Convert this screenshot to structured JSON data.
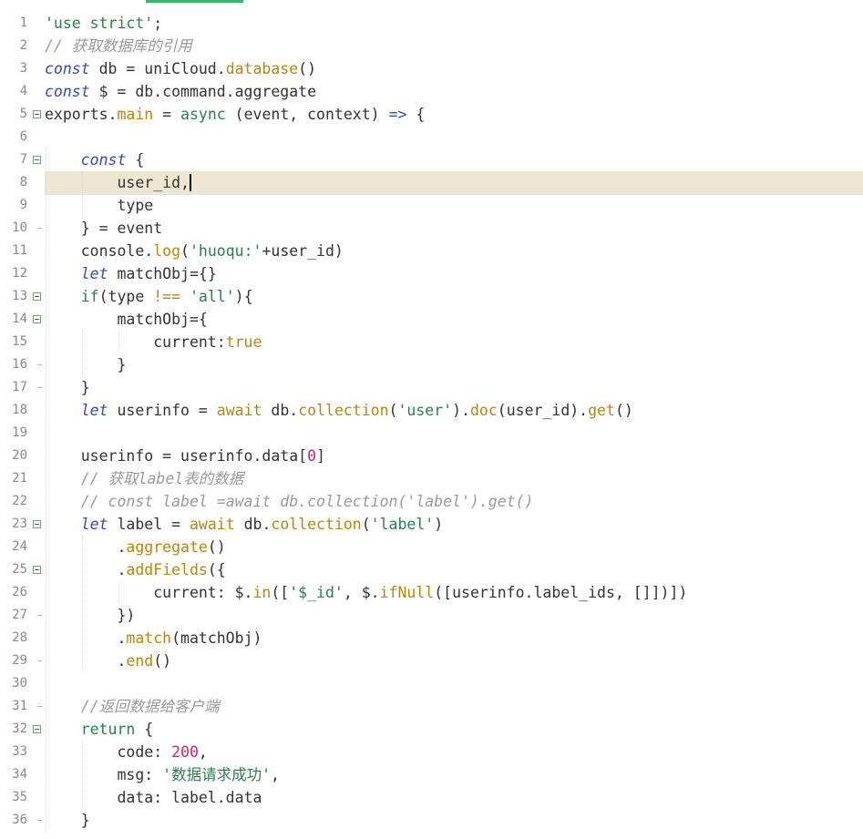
{
  "editor": {
    "lines": [
      {
        "n": "1",
        "fold": "",
        "tokens": [
          {
            "t": "'use strict'",
            "c": "str"
          },
          {
            "t": ";",
            "c": "plain"
          }
        ]
      },
      {
        "n": "2",
        "fold": "",
        "tokens": [
          {
            "t": "// 获取数据库的引用",
            "c": "cmt"
          }
        ]
      },
      {
        "n": "3",
        "fold": "",
        "tokens": [
          {
            "t": "const",
            "c": "kw"
          },
          {
            "t": " db = uniCloud.",
            "c": "plain"
          },
          {
            "t": "database",
            "c": "fn"
          },
          {
            "t": "()",
            "c": "plain"
          }
        ]
      },
      {
        "n": "4",
        "fold": "",
        "tokens": [
          {
            "t": "const",
            "c": "kw"
          },
          {
            "t": " $ = db.command.aggregate",
            "c": "plain"
          }
        ]
      },
      {
        "n": "5",
        "fold": "box",
        "tokens": [
          {
            "t": "exports.",
            "c": "plain"
          },
          {
            "t": "main",
            "c": "fn"
          },
          {
            "t": " = ",
            "c": "plain"
          },
          {
            "t": "async",
            "c": "kw2"
          },
          {
            "t": " (event, context) ",
            "c": "plain"
          },
          {
            "t": "=>",
            "c": "kw"
          },
          {
            "t": " {",
            "c": "plain"
          }
        ]
      },
      {
        "n": "6",
        "fold": "",
        "tokens": []
      },
      {
        "n": "7",
        "fold": "box",
        "tokens": [
          {
            "t": "    ",
            "c": "plain"
          },
          {
            "t": "const",
            "c": "kw"
          },
          {
            "t": " {",
            "c": "plain"
          }
        ]
      },
      {
        "n": "8",
        "fold": "",
        "tokens": [
          {
            "t": "        user_id,",
            "c": "plain"
          }
        ]
      },
      {
        "n": "9",
        "fold": "",
        "tokens": [
          {
            "t": "        type",
            "c": "plain"
          }
        ]
      },
      {
        "n": "10",
        "fold": "tick",
        "tokens": [
          {
            "t": "    } = event",
            "c": "plain"
          }
        ]
      },
      {
        "n": "11",
        "fold": "",
        "tokens": [
          {
            "t": "    console.",
            "c": "plain"
          },
          {
            "t": "log",
            "c": "fn"
          },
          {
            "t": "(",
            "c": "plain"
          },
          {
            "t": "'huoqu:'",
            "c": "str"
          },
          {
            "t": "+user_id)",
            "c": "plain"
          }
        ]
      },
      {
        "n": "12",
        "fold": "",
        "tokens": [
          {
            "t": "    ",
            "c": "plain"
          },
          {
            "t": "let",
            "c": "kw"
          },
          {
            "t": " matchObj={}",
            "c": "plain"
          }
        ]
      },
      {
        "n": "13",
        "fold": "box",
        "tokens": [
          {
            "t": "    ",
            "c": "plain"
          },
          {
            "t": "if",
            "c": "kw2"
          },
          {
            "t": "(type ",
            "c": "plain"
          },
          {
            "t": "!==",
            "c": "fn"
          },
          {
            "t": " ",
            "c": "plain"
          },
          {
            "t": "'all'",
            "c": "str"
          },
          {
            "t": "){",
            "c": "plain"
          }
        ]
      },
      {
        "n": "14",
        "fold": "box",
        "tokens": [
          {
            "t": "        matchObj={",
            "c": "plain"
          }
        ]
      },
      {
        "n": "15",
        "fold": "",
        "tokens": [
          {
            "t": "            current:",
            "c": "plain"
          },
          {
            "t": "true",
            "c": "bool"
          }
        ]
      },
      {
        "n": "16",
        "fold": "tick",
        "tokens": [
          {
            "t": "        }",
            "c": "plain"
          }
        ]
      },
      {
        "n": "17",
        "fold": "tick",
        "tokens": [
          {
            "t": "    }",
            "c": "plain"
          }
        ]
      },
      {
        "n": "18",
        "fold": "",
        "tokens": [
          {
            "t": "    ",
            "c": "plain"
          },
          {
            "t": "let",
            "c": "kw"
          },
          {
            "t": " userinfo = ",
            "c": "plain"
          },
          {
            "t": "await",
            "c": "fn"
          },
          {
            "t": " db.",
            "c": "plain"
          },
          {
            "t": "collection",
            "c": "fn"
          },
          {
            "t": "(",
            "c": "plain"
          },
          {
            "t": "'user'",
            "c": "str"
          },
          {
            "t": ").",
            "c": "plain"
          },
          {
            "t": "doc",
            "c": "fn"
          },
          {
            "t": "(user_id).",
            "c": "plain"
          },
          {
            "t": "get",
            "c": "fn"
          },
          {
            "t": "()",
            "c": "plain"
          }
        ]
      },
      {
        "n": "19",
        "fold": "",
        "tokens": []
      },
      {
        "n": "20",
        "fold": "",
        "tokens": [
          {
            "t": "    userinfo = userinfo.data[",
            "c": "plain"
          },
          {
            "t": "0",
            "c": "num"
          },
          {
            "t": "]",
            "c": "plain"
          }
        ]
      },
      {
        "n": "21",
        "fold": "",
        "tokens": [
          {
            "t": "    ",
            "c": "plain"
          },
          {
            "t": "// 获取label表的数据",
            "c": "cmt"
          }
        ]
      },
      {
        "n": "22",
        "fold": "",
        "tokens": [
          {
            "t": "    ",
            "c": "plain"
          },
          {
            "t": "// const label =await db.collection('label').get()",
            "c": "cmt"
          }
        ]
      },
      {
        "n": "23",
        "fold": "box",
        "tokens": [
          {
            "t": "    ",
            "c": "plain"
          },
          {
            "t": "let",
            "c": "kw"
          },
          {
            "t": " label = ",
            "c": "plain"
          },
          {
            "t": "await",
            "c": "fn"
          },
          {
            "t": " db.",
            "c": "plain"
          },
          {
            "t": "collection",
            "c": "fn"
          },
          {
            "t": "(",
            "c": "plain"
          },
          {
            "t": "'label'",
            "c": "str"
          },
          {
            "t": ")",
            "c": "plain"
          }
        ]
      },
      {
        "n": "24",
        "fold": "",
        "tokens": [
          {
            "t": "        .",
            "c": "plain"
          },
          {
            "t": "aggregate",
            "c": "fn"
          },
          {
            "t": "()",
            "c": "plain"
          }
        ]
      },
      {
        "n": "25",
        "fold": "box",
        "tokens": [
          {
            "t": "        .",
            "c": "plain"
          },
          {
            "t": "addFields",
            "c": "fn"
          },
          {
            "t": "({",
            "c": "plain"
          }
        ]
      },
      {
        "n": "26",
        "fold": "",
        "tokens": [
          {
            "t": "            current: $.",
            "c": "plain"
          },
          {
            "t": "in",
            "c": "fn"
          },
          {
            "t": "([",
            "c": "plain"
          },
          {
            "t": "'$_id'",
            "c": "str"
          },
          {
            "t": ", $.",
            "c": "plain"
          },
          {
            "t": "ifNull",
            "c": "fn"
          },
          {
            "t": "([userinfo.label_ids, []])])",
            "c": "plain"
          }
        ]
      },
      {
        "n": "27",
        "fold": "tick",
        "tokens": [
          {
            "t": "        })",
            "c": "plain"
          }
        ]
      },
      {
        "n": "28",
        "fold": "",
        "tokens": [
          {
            "t": "        .",
            "c": "plain"
          },
          {
            "t": "match",
            "c": "fn"
          },
          {
            "t": "(matchObj)",
            "c": "plain"
          }
        ]
      },
      {
        "n": "29",
        "fold": "tick",
        "tokens": [
          {
            "t": "        .",
            "c": "plain"
          },
          {
            "t": "end",
            "c": "fn"
          },
          {
            "t": "()",
            "c": "plain"
          }
        ]
      },
      {
        "n": "30",
        "fold": "",
        "tokens": []
      },
      {
        "n": "31",
        "fold": "tick",
        "tokens": [
          {
            "t": "    ",
            "c": "plain"
          },
          {
            "t": "//返回数据给客户端",
            "c": "cmt"
          }
        ]
      },
      {
        "n": "32",
        "fold": "box",
        "tokens": [
          {
            "t": "    ",
            "c": "plain"
          },
          {
            "t": "return",
            "c": "kw2"
          },
          {
            "t": " {",
            "c": "plain"
          }
        ]
      },
      {
        "n": "33",
        "fold": "",
        "tokens": [
          {
            "t": "        code: ",
            "c": "plain"
          },
          {
            "t": "200",
            "c": "num"
          },
          {
            "t": ",",
            "c": "plain"
          }
        ]
      },
      {
        "n": "34",
        "fold": "",
        "tokens": [
          {
            "t": "        msg: ",
            "c": "plain"
          },
          {
            "t": "'数据请求成功'",
            "c": "str"
          },
          {
            "t": ",",
            "c": "plain"
          }
        ]
      },
      {
        "n": "35",
        "fold": "",
        "tokens": [
          {
            "t": "        data: label.data",
            "c": "plain"
          }
        ]
      },
      {
        "n": "36",
        "fold": "tick",
        "tokens": [
          {
            "t": "    }",
            "c": "plain"
          }
        ]
      }
    ],
    "current_line": "8",
    "colors": {
      "keyword": "#3949ab",
      "string": "#2e7d4f",
      "comment": "#9a9a9a",
      "function": "#b8860b",
      "number": "#d0266c",
      "current_line_bg": "#ede6d2",
      "scroll_indicator": "#3cb46a"
    }
  }
}
